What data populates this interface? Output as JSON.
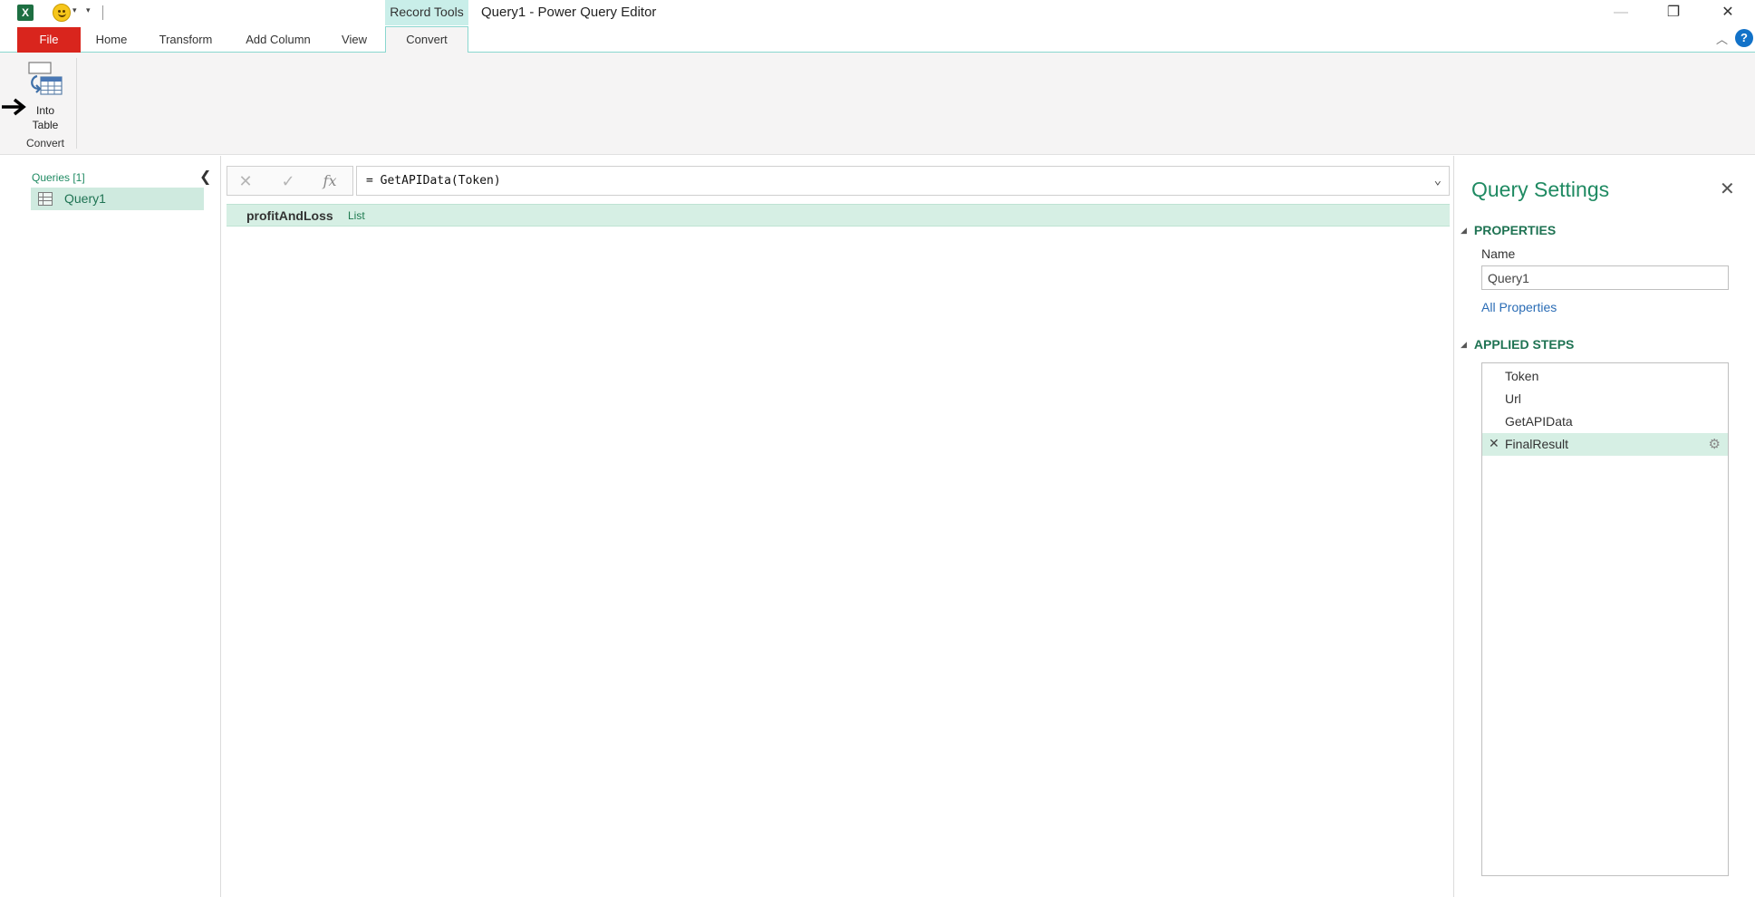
{
  "titlebar": {
    "app_icon": "excel-icon",
    "contextual_group": "Record Tools",
    "window_title": "Query1 - Power Query Editor",
    "controls": [
      "minimize-icon",
      "restore-icon",
      "close-icon"
    ]
  },
  "ribbon": {
    "tabs": [
      {
        "label": "File"
      },
      {
        "label": "Home"
      },
      {
        "label": "Transform"
      },
      {
        "label": "Add Column"
      },
      {
        "label": "View"
      },
      {
        "label": "Convert"
      }
    ],
    "active_tab": "Convert",
    "into_table_line1": "Into",
    "into_table_line2": "Table",
    "group_label": "Convert",
    "help": "?"
  },
  "queries": {
    "title": "Queries [1]",
    "items": [
      {
        "label": "Query1",
        "icon": "table-icon"
      }
    ]
  },
  "formula_bar": {
    "formula": "= GetAPIData(Token)",
    "fx": "fx"
  },
  "record": {
    "field": "profitAndLoss",
    "value": "List"
  },
  "settings": {
    "title": "Query Settings",
    "properties_header": "PROPERTIES",
    "name_label": "Name",
    "name_value": "Query1",
    "all_properties": "All Properties",
    "steps_header": "APPLIED STEPS",
    "steps": [
      {
        "label": "Token"
      },
      {
        "label": "Url"
      },
      {
        "label": "GetAPIData"
      },
      {
        "label": "FinalResult",
        "selected": true
      }
    ]
  },
  "colors": {
    "accent_green": "#1f8a62",
    "file_tab_red": "#d9251d",
    "selection_green": "#d6efe4",
    "contextual_teal": "#c9eee9"
  }
}
